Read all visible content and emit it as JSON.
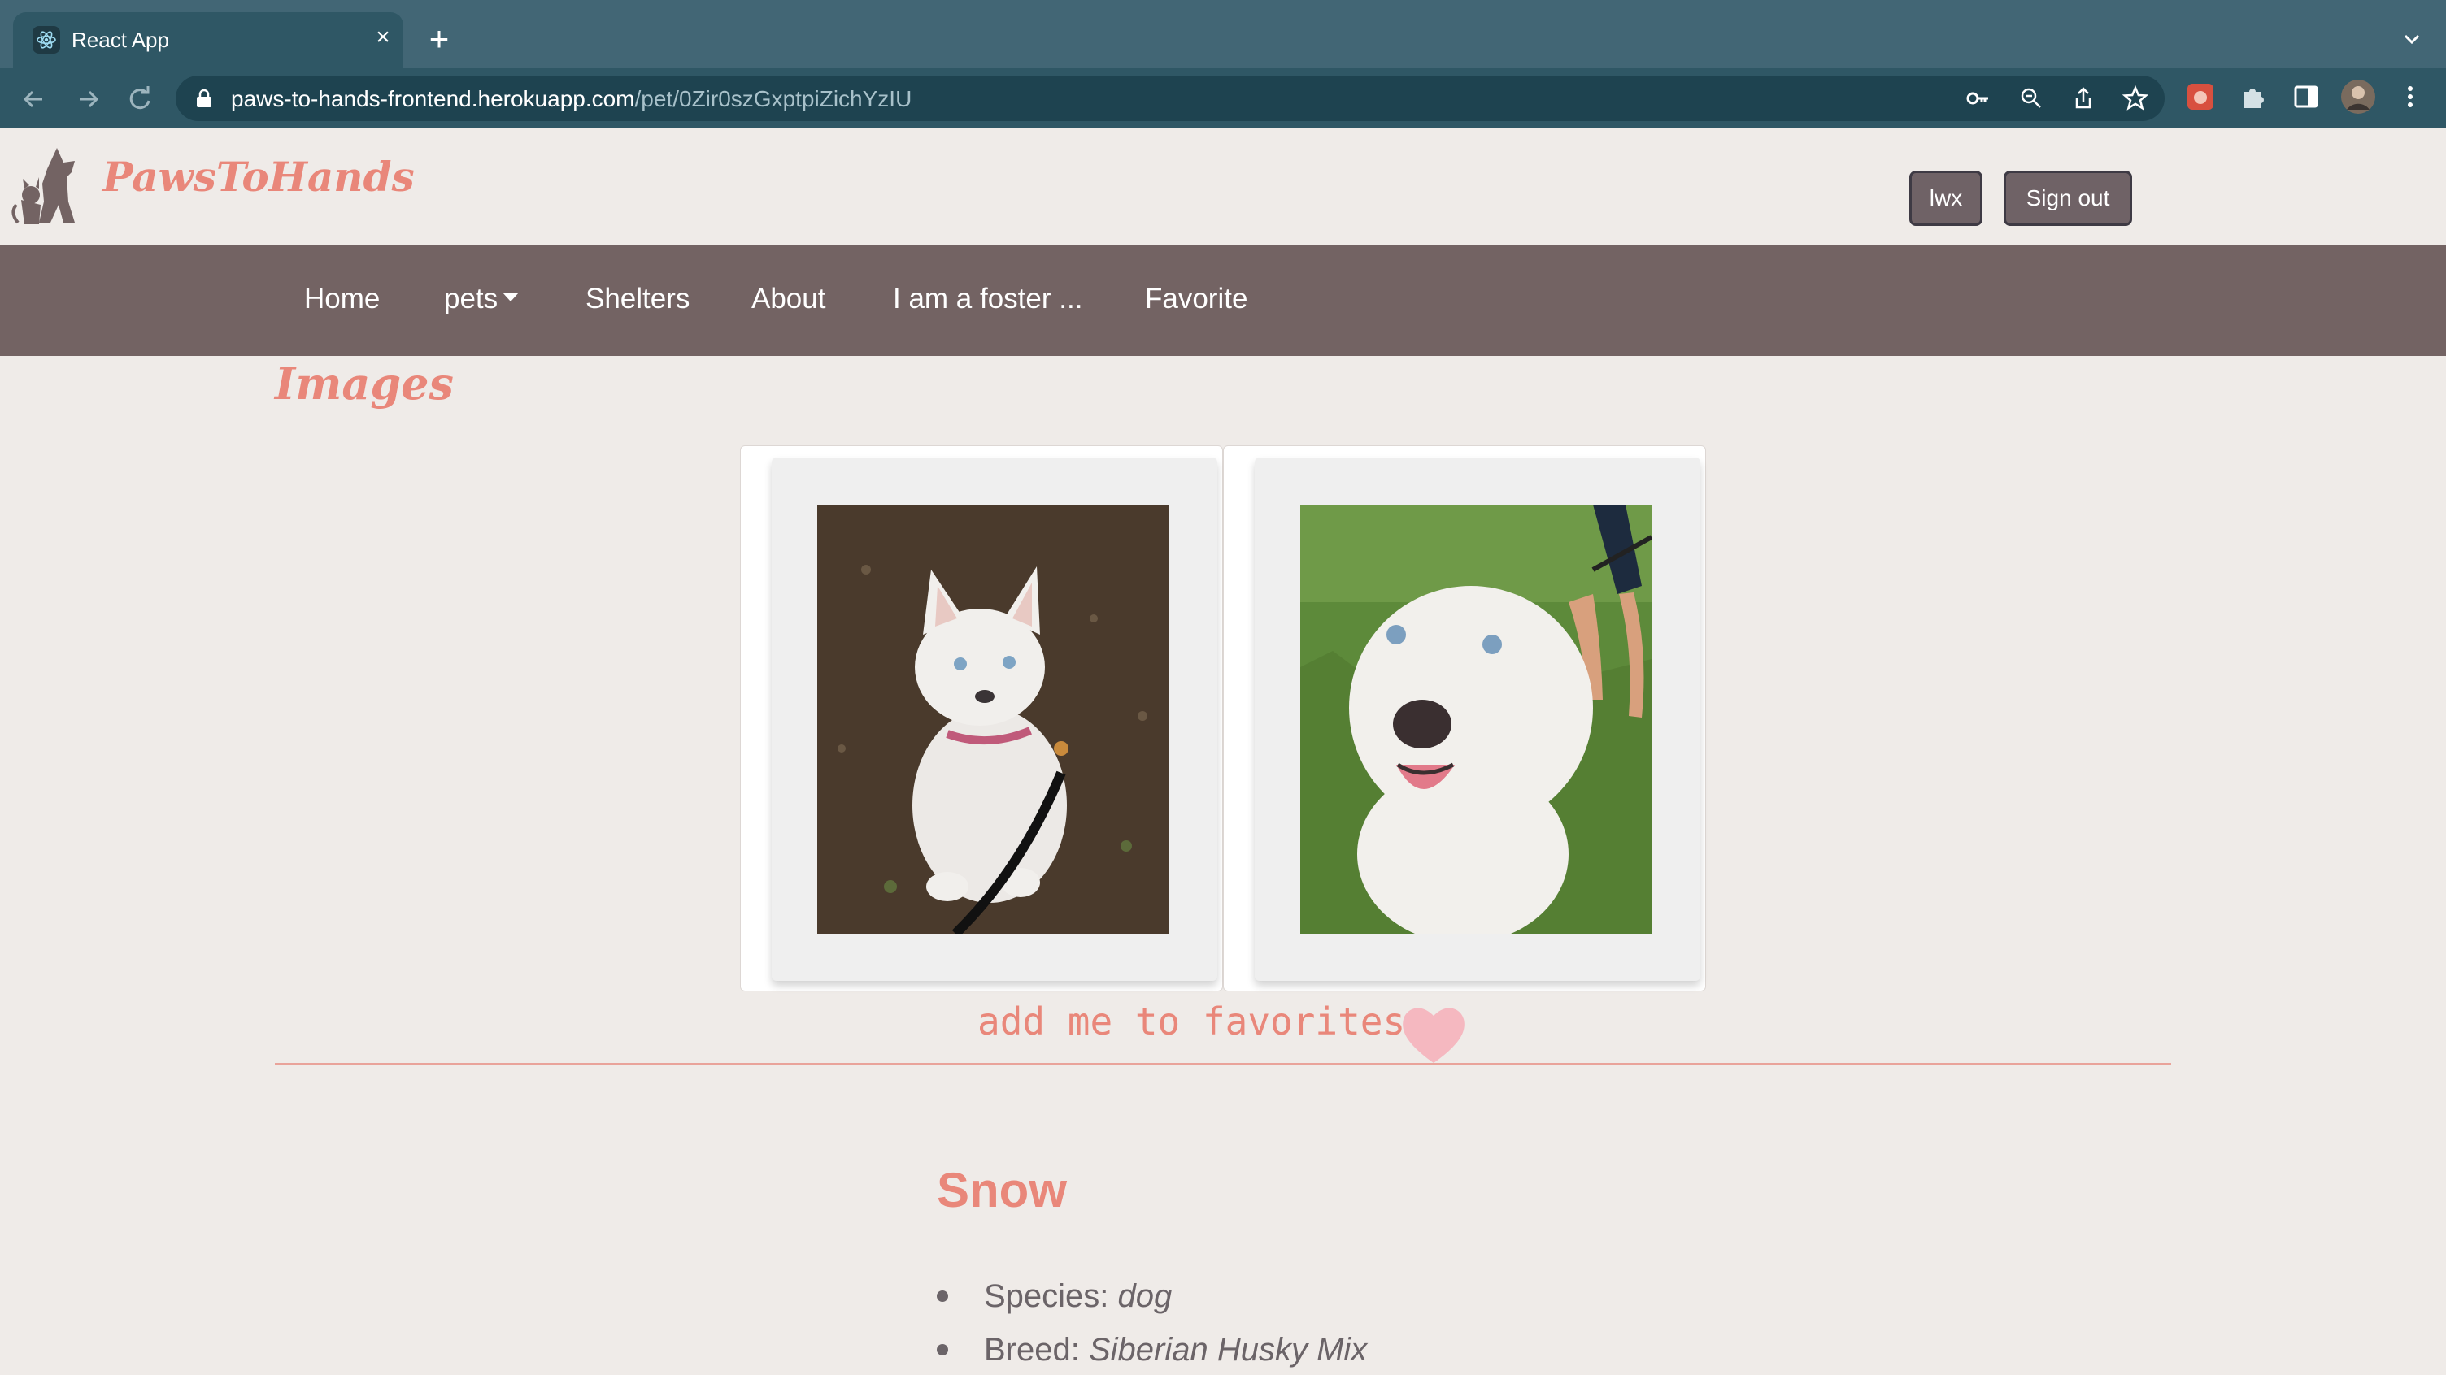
{
  "browser": {
    "tab_title": "React App",
    "url_host": "paws-to-hands-frontend.herokuapp.com",
    "url_path": "/pet/0Zir0szGxptpiZichYzIU",
    "colors": {
      "tabbar": "#426675",
      "toolbar": "#2f5765"
    }
  },
  "header": {
    "brand": "PawsToHands",
    "user_button": "lwx",
    "signout_button": "Sign out"
  },
  "nav": {
    "items": [
      "Home",
      "pets",
      "Shelters",
      "About",
      "I am a foster ...",
      "Favorite"
    ]
  },
  "images_section": {
    "title": "Images",
    "photos": [
      {
        "icon": "husky-photo-dirt"
      },
      {
        "icon": "husky-photo-grass"
      }
    ]
  },
  "favorite": {
    "label": "add me to favorites",
    "icon": "heart-icon",
    "color": "#f5b8c0"
  },
  "pet": {
    "name": "Snow",
    "species_label": "Species:",
    "species": "dog",
    "breed_label": "Breed:",
    "breed": "Siberian Husky Mix"
  },
  "theme": {
    "accent": "#e9877a",
    "navbar": "#736363",
    "background": "#efebe8"
  }
}
